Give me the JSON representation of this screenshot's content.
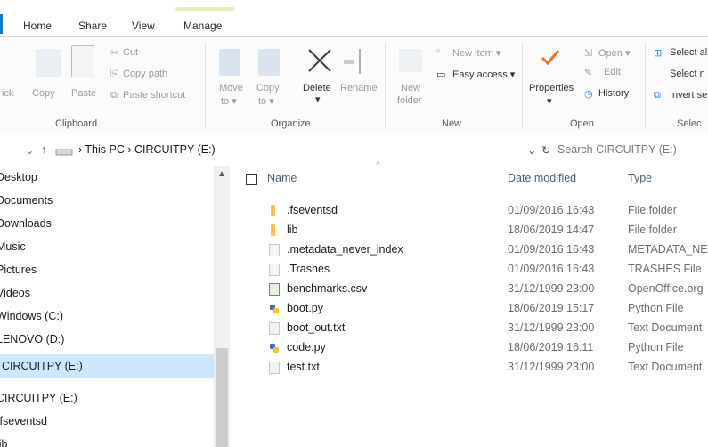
{
  "tabs": {
    "home": "Home",
    "share": "Share",
    "view": "View",
    "manage": "Manage"
  },
  "ribbon": {
    "clipboard": {
      "label": "Clipboard",
      "pin_partial": "ick",
      "copy": "Copy",
      "paste": "Paste",
      "cut": "Cut",
      "copy_path": "Copy path",
      "paste_shortcut": "Paste shortcut"
    },
    "organize": {
      "label": "Organize",
      "move_to": "Move",
      "move_to_2": "to ▾",
      "copy_to": "Copy",
      "copy_to_2": "to ▾",
      "delete": "Delete",
      "delete_arrow": "▾",
      "rename": "Rename"
    },
    "new": {
      "label": "New",
      "new_folder": "New",
      "new_folder_2": "folder",
      "new_item": "New item ▾",
      "easy_access": "Easy access ▾"
    },
    "open": {
      "label": "Open",
      "properties": "Properties",
      "properties_arrow": "▾",
      "open": "Open ▾",
      "edit": "Edit",
      "history": "History"
    },
    "select": {
      "label": "Selec",
      "select_all": "Select al",
      "select_none": "Select n",
      "invert": "Invert se"
    }
  },
  "address": {
    "back": "‹",
    "down": "⌄",
    "up": "↑",
    "path": "› This PC › CIRCUITPY (E:)",
    "dropdown": "⌄",
    "refresh": "↻",
    "search_placeholder": "Search CIRCUITPY (E:)"
  },
  "nav": {
    "items": [
      {
        "label": "Desktop"
      },
      {
        "label": "Documents"
      },
      {
        "label": "Downloads"
      },
      {
        "label": "Music"
      },
      {
        "label": "Pictures"
      },
      {
        "label": "Videos"
      },
      {
        "label": "Windows (C:)"
      },
      {
        "label": "LENOVO (D:)"
      },
      {
        "label": "CIRCUITPY (E:)"
      },
      {
        "label": "CIRCUITPY (E:)"
      },
      {
        "label": ".fseventsd"
      },
      {
        "label": "lib"
      }
    ],
    "scroll_up": "▲"
  },
  "files": {
    "headers": {
      "name": "Name",
      "date": "Date modified",
      "type": "Type",
      "sort_caret": "^"
    },
    "rows": [
      {
        "name": ".fseventsd",
        "date": "01/09/2016 16:43",
        "type": "File folder",
        "icon": "folder-icon"
      },
      {
        "name": "lib",
        "date": "18/06/2019 14:47",
        "type": "File folder",
        "icon": "folder-icon"
      },
      {
        "name": ".metadata_never_index",
        "date": "01/09/2016 16:43",
        "type": "METADATA_NEV",
        "icon": "file-icon"
      },
      {
        "name": ".Trashes",
        "date": "01/09/2016 16:43",
        "type": "TRASHES File",
        "icon": "file-icon"
      },
      {
        "name": "benchmarks.csv",
        "date": "31/12/1999 23:00",
        "type": "OpenOffice.org",
        "icon": "spreadsheet-icon"
      },
      {
        "name": "boot.py",
        "date": "18/06/2019 15:17",
        "type": "Python File",
        "icon": "python-icon"
      },
      {
        "name": "boot_out.txt",
        "date": "31/12/1999 23:00",
        "type": "Text Document",
        "icon": "text-file-icon"
      },
      {
        "name": "code.py",
        "date": "18/06/2019 16:11",
        "type": "Python File",
        "icon": "python-icon"
      },
      {
        "name": "test.txt",
        "date": "31/12/1999 23:00",
        "type": "Text Document",
        "icon": "text-file-icon"
      }
    ]
  },
  "colors": {
    "accent": "#1979ca",
    "selection": "#cce8ff",
    "manage_tab": "#e7f0b4",
    "folder": "#f3c343",
    "check": "#e8701f"
  }
}
